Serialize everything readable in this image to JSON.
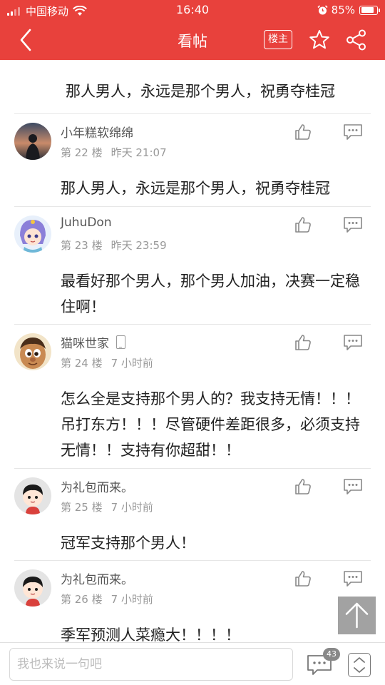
{
  "status_bar": {
    "carrier": "中国移动",
    "time": "16:40",
    "battery": "85%",
    "battery_level": 0.85,
    "icons": [
      "signal-icon",
      "wifi-icon",
      "alarm-icon",
      "battery-icon"
    ]
  },
  "nav": {
    "title": "看帖",
    "louzhu_label": "楼主",
    "icons": [
      "back-icon",
      "star-icon",
      "share-icon"
    ]
  },
  "first_post_text": "那人男人，永远是那个男人，祝勇夺桂冠",
  "replies": [
    {
      "username": "小年糕软绵绵",
      "floor": "第 22 楼",
      "time": "昨天 21:07",
      "text": "那人男人，永远是那个男人，祝勇夺桂冠",
      "device_icon": false
    },
    {
      "username": "JuhuDon",
      "floor": "第 23 楼",
      "time": "昨天 23:59",
      "text": "最看好那个男人，那个男人加油，决赛一定稳住啊！",
      "device_icon": false
    },
    {
      "username": "猫咪世家",
      "floor": "第 24 楼",
      "time": "7 小时前",
      "text": "怎么全是支持那个男人的？我支持无情！！！吊打东方！！！尽管硬件差距很多，必须支持无情！！支持有你超甜！！",
      "device_icon": true
    },
    {
      "username": "为礼包而来。",
      "floor": "第 25 楼",
      "time": "7 小时前",
      "text": "冠军支持那个男人！",
      "device_icon": false
    },
    {
      "username": "为礼包而来。",
      "floor": "第 26 楼",
      "time": "7 小时前",
      "text": "季军预测人菜瘾大！！！！",
      "device_icon": false
    }
  ],
  "bottom_bar": {
    "input_placeholder": "我也来说一句吧",
    "comment_count": "43"
  },
  "colors": {
    "brand_red": "#e8413c",
    "meta_gray": "#999999"
  }
}
